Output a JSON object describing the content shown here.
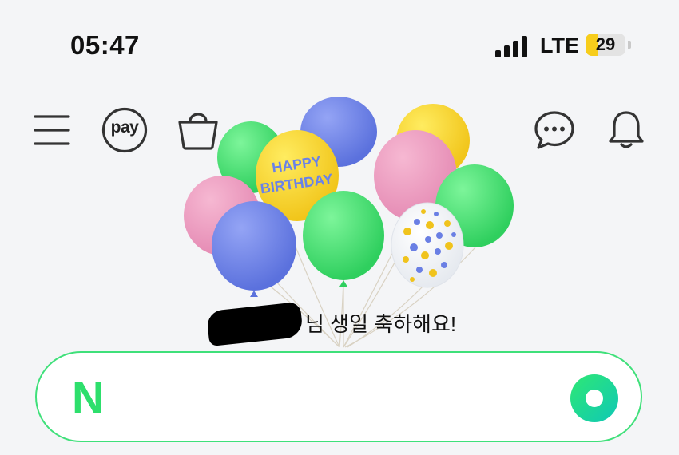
{
  "status_bar": {
    "time": "05:47",
    "network": "LTE",
    "battery": "29",
    "battery_level": 0.29
  },
  "header": {
    "menu_icon": "hamburger-menu-icon",
    "pay_label": "pay",
    "shopping_icon": "shopping-bag-icon",
    "chat_icon": "chat-bubble-icon",
    "notification_icon": "bell-icon"
  },
  "banner": {
    "balloon_text_line1": "HAPPY",
    "balloon_text_line2": "BIRTHDAY",
    "greeting": "님 생일 축하해요!"
  },
  "search": {
    "logo": "N",
    "accent_color": "#2ddf6c"
  }
}
